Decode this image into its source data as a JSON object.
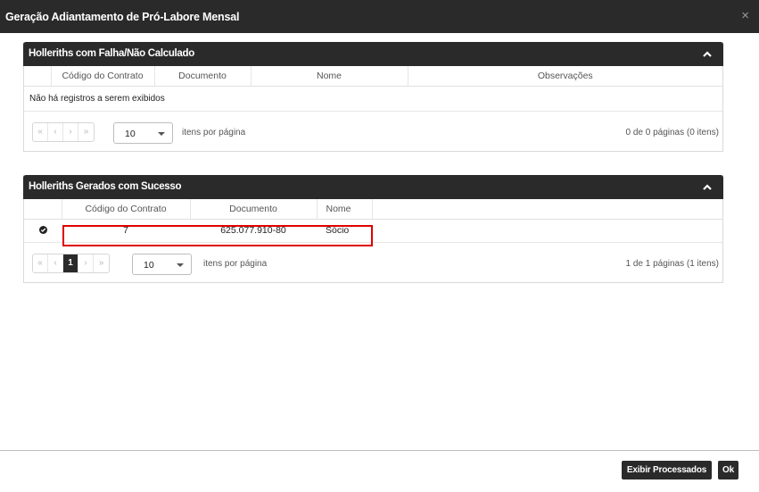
{
  "modal": {
    "title": "Geração Adiantamento de Pró-Labore Mensal",
    "close": "×"
  },
  "failed_panel": {
    "title": "Holleriths com Falha/Não Calculado",
    "columns": [
      "Código do Contrato",
      "Documento",
      "Nome",
      "Observações"
    ],
    "empty_message": "Não há registros a serem exibidos",
    "pager": {
      "first": "«",
      "prev": "‹",
      "next": "›",
      "last": "»",
      "page_size": "10",
      "page_size_label": "itens por página",
      "info": "0 de 0 páginas (0 itens)"
    }
  },
  "success_panel": {
    "title": "Holleriths Gerados com Sucesso",
    "columns": [
      "Código do Contrato",
      "Documento",
      "Nome"
    ],
    "rows": [
      {
        "codigo": "7",
        "documento": "625.077.910-80",
        "nome": "Sócio"
      }
    ],
    "pager": {
      "first": "«",
      "prev": "‹",
      "current_page": "1",
      "next": "›",
      "last": "»",
      "page_size": "10",
      "page_size_label": "itens por página",
      "info": "1 de 1 páginas (1 itens)"
    }
  },
  "footer": {
    "show_processed_label": "Exibir Processados",
    "ok_label": "Ok"
  },
  "icons": {
    "collapse": "chevron-up-icon",
    "row_status": "check-circle-icon"
  },
  "colors": {
    "header_bg": "#2a2a2a",
    "highlight": "#e00000"
  }
}
